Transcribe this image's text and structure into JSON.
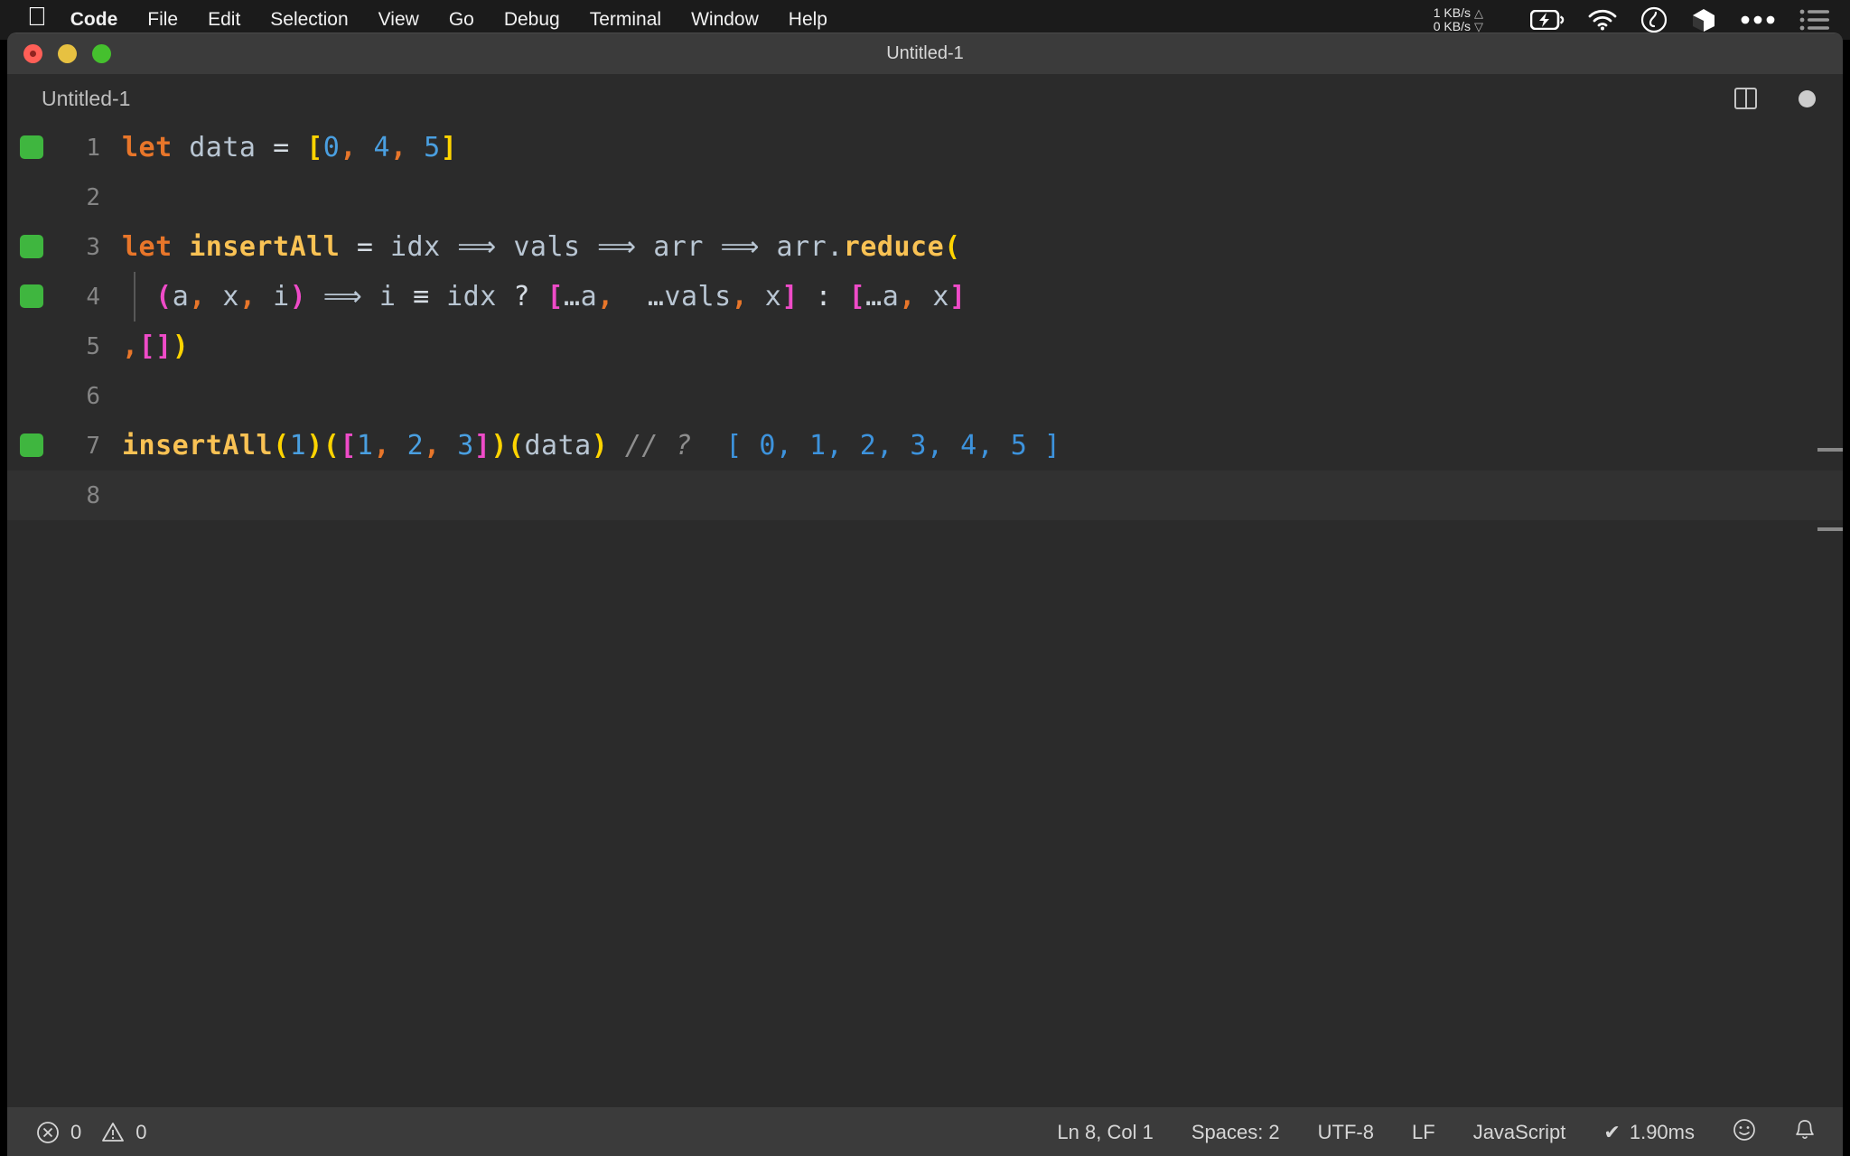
{
  "menubar": {
    "apple_icon": "apple-logo",
    "items": [
      {
        "label": "Code",
        "bold": true
      },
      {
        "label": "File",
        "bold": false
      },
      {
        "label": "Edit",
        "bold": false
      },
      {
        "label": "Selection",
        "bold": false
      },
      {
        "label": "View",
        "bold": false
      },
      {
        "label": "Go",
        "bold": false
      },
      {
        "label": "Debug",
        "bold": false
      },
      {
        "label": "Terminal",
        "bold": false
      },
      {
        "label": "Window",
        "bold": false
      },
      {
        "label": "Help",
        "bold": false
      }
    ],
    "network": {
      "up": "1 KB/s",
      "down": "0 KB/s",
      "up_arrow": "△",
      "down_arrow": "▽"
    },
    "tray_icons": [
      "battery-charging-icon",
      "wifi-icon",
      "clock-icon",
      "dropbox-icon",
      "ellipsis-icon",
      "control-center-icon"
    ]
  },
  "window": {
    "title": "Untitled-1",
    "traffic_lights": [
      "close-button",
      "minimize-button",
      "zoom-button"
    ]
  },
  "tabbar": {
    "tab_label": "Untitled-1",
    "split_icon": "split-editor-icon",
    "dirty_icon": "unsaved-changes-dot"
  },
  "editor": {
    "language": "JavaScript",
    "lines": [
      {
        "number": "1",
        "quokka": true,
        "current": false,
        "indent_guide": false,
        "tokens": [
          {
            "t": "let",
            "c": "t-kw"
          },
          {
            "t": " ",
            "c": "t-op"
          },
          {
            "t": "data",
            "c": "t-var"
          },
          {
            "t": " ",
            "c": "t-op"
          },
          {
            "t": "=",
            "c": "t-op"
          },
          {
            "t": " ",
            "c": "t-op"
          },
          {
            "t": "[",
            "c": "t-brkt-y"
          },
          {
            "t": "0",
            "c": "t-num"
          },
          {
            "t": ",",
            "c": "t-comma"
          },
          {
            "t": " ",
            "c": "t-op"
          },
          {
            "t": "4",
            "c": "t-num"
          },
          {
            "t": ",",
            "c": "t-comma"
          },
          {
            "t": " ",
            "c": "t-op"
          },
          {
            "t": "5",
            "c": "t-num"
          },
          {
            "t": "]",
            "c": "t-brkt-y"
          }
        ]
      },
      {
        "number": "2",
        "quokka": false,
        "current": false,
        "indent_guide": false,
        "tokens": []
      },
      {
        "number": "3",
        "quokka": true,
        "current": false,
        "indent_guide": false,
        "tokens": [
          {
            "t": "let",
            "c": "t-kw"
          },
          {
            "t": " ",
            "c": "t-op"
          },
          {
            "t": "insertAll",
            "c": "t-fn"
          },
          {
            "t": " ",
            "c": "t-op"
          },
          {
            "t": "=",
            "c": "t-op"
          },
          {
            "t": " ",
            "c": "t-op"
          },
          {
            "t": "idx",
            "c": "t-var"
          },
          {
            "t": " ",
            "c": "t-op"
          },
          {
            "t": "⟹",
            "c": "t-arrow"
          },
          {
            "t": " ",
            "c": "t-op"
          },
          {
            "t": "vals",
            "c": "t-var"
          },
          {
            "t": " ",
            "c": "t-op"
          },
          {
            "t": "⟹",
            "c": "t-arrow"
          },
          {
            "t": " ",
            "c": "t-op"
          },
          {
            "t": "arr",
            "c": "t-var"
          },
          {
            "t": " ",
            "c": "t-op"
          },
          {
            "t": "⟹",
            "c": "t-arrow"
          },
          {
            "t": " ",
            "c": "t-op"
          },
          {
            "t": "arr",
            "c": "t-var"
          },
          {
            "t": ".",
            "c": "t-var"
          },
          {
            "t": "reduce",
            "c": "t-fn"
          },
          {
            "t": "(",
            "c": "t-brkt-y"
          }
        ]
      },
      {
        "number": "4",
        "quokka": true,
        "current": false,
        "indent_guide": true,
        "tokens": [
          {
            "t": "  ",
            "c": "t-op"
          },
          {
            "t": "(",
            "c": "t-brkt-m"
          },
          {
            "t": "a",
            "c": "t-var"
          },
          {
            "t": ",",
            "c": "t-comma"
          },
          {
            "t": " ",
            "c": "t-op"
          },
          {
            "t": "x",
            "c": "t-var"
          },
          {
            "t": ",",
            "c": "t-comma"
          },
          {
            "t": " ",
            "c": "t-op"
          },
          {
            "t": "i",
            "c": "t-var"
          },
          {
            "t": ")",
            "c": "t-brkt-m"
          },
          {
            "t": " ",
            "c": "t-op"
          },
          {
            "t": "⟹",
            "c": "t-arrow"
          },
          {
            "t": " ",
            "c": "t-op"
          },
          {
            "t": "i",
            "c": "t-var"
          },
          {
            "t": " ",
            "c": "t-op"
          },
          {
            "t": "≡",
            "c": "t-op"
          },
          {
            "t": " ",
            "c": "t-op"
          },
          {
            "t": "idx",
            "c": "t-var"
          },
          {
            "t": " ",
            "c": "t-op"
          },
          {
            "t": "?",
            "c": "t-op"
          },
          {
            "t": " ",
            "c": "t-op"
          },
          {
            "t": "[",
            "c": "t-brkt-m"
          },
          {
            "t": "…",
            "c": "t-spread"
          },
          {
            "t": "a",
            "c": "t-var"
          },
          {
            "t": ",",
            "c": "t-comma"
          },
          {
            "t": "  ",
            "c": "t-op"
          },
          {
            "t": "…",
            "c": "t-spread"
          },
          {
            "t": "vals",
            "c": "t-var"
          },
          {
            "t": ",",
            "c": "t-comma"
          },
          {
            "t": " ",
            "c": "t-op"
          },
          {
            "t": "x",
            "c": "t-var"
          },
          {
            "t": "]",
            "c": "t-brkt-m"
          },
          {
            "t": " ",
            "c": "t-op"
          },
          {
            "t": ":",
            "c": "t-op"
          },
          {
            "t": " ",
            "c": "t-op"
          },
          {
            "t": "[",
            "c": "t-brkt-m"
          },
          {
            "t": "…",
            "c": "t-spread"
          },
          {
            "t": "a",
            "c": "t-var"
          },
          {
            "t": ",",
            "c": "t-comma"
          },
          {
            "t": " ",
            "c": "t-op"
          },
          {
            "t": "x",
            "c": "t-var"
          },
          {
            "t": "]",
            "c": "t-brkt-m"
          }
        ]
      },
      {
        "number": "5",
        "quokka": false,
        "current": false,
        "indent_guide": false,
        "tokens": [
          {
            "t": ",",
            "c": "t-comma"
          },
          {
            "t": "[",
            "c": "t-brkt-m"
          },
          {
            "t": "]",
            "c": "t-brkt-m"
          },
          {
            "t": ")",
            "c": "t-brkt-y"
          }
        ]
      },
      {
        "number": "6",
        "quokka": false,
        "current": false,
        "indent_guide": false,
        "tokens": []
      },
      {
        "number": "7",
        "quokka": true,
        "current": false,
        "indent_guide": false,
        "tokens": [
          {
            "t": "insertAll",
            "c": "t-fn"
          },
          {
            "t": "(",
            "c": "t-brkt-y"
          },
          {
            "t": "1",
            "c": "t-num"
          },
          {
            "t": ")",
            "c": "t-brkt-y"
          },
          {
            "t": "(",
            "c": "t-brkt-y"
          },
          {
            "t": "[",
            "c": "t-brkt-m"
          },
          {
            "t": "1",
            "c": "t-num"
          },
          {
            "t": ",",
            "c": "t-comma"
          },
          {
            "t": " ",
            "c": "t-op"
          },
          {
            "t": "2",
            "c": "t-num"
          },
          {
            "t": ",",
            "c": "t-comma"
          },
          {
            "t": " ",
            "c": "t-op"
          },
          {
            "t": "3",
            "c": "t-num"
          },
          {
            "t": "]",
            "c": "t-brkt-m"
          },
          {
            "t": ")",
            "c": "t-brkt-y"
          },
          {
            "t": "(",
            "c": "t-brkt-y"
          },
          {
            "t": "data",
            "c": "t-var"
          },
          {
            "t": ")",
            "c": "t-brkt-y"
          },
          {
            "t": " ",
            "c": "t-op"
          },
          {
            "t": "// ?",
            "c": "t-comment"
          },
          {
            "t": "  ",
            "c": "t-op"
          },
          {
            "t": "[ 0, 1, 2, 3, 4, 5 ]",
            "c": "t-result"
          }
        ]
      },
      {
        "number": "8",
        "quokka": false,
        "current": true,
        "indent_guide": false,
        "tokens": []
      }
    ]
  },
  "statusbar": {
    "errors": "0",
    "warnings": "0",
    "error_icon": "error-circle-icon",
    "warning_icon": "warning-triangle-icon",
    "cursor_position": "Ln 8, Col 1",
    "indentation": "Spaces: 2",
    "encoding": "UTF-8",
    "eol": "LF",
    "language": "JavaScript",
    "run_time": "1.90ms",
    "run_check": "✔",
    "feedback_icon": "smiley-icon",
    "notifications_icon": "bell-icon"
  },
  "colors": {
    "editor_background": "#2b2b2b",
    "chrome_background": "#3b3b3b",
    "keyword": "#e8762a",
    "function": "#f9c254",
    "number": "#4a9fe0",
    "bracket_yellow": "#ffd400",
    "bracket_magenta": "#ef4bc8",
    "variable": "#b9c6d3",
    "comment": "#8e8e8e",
    "quokka_pass": "#3fb63f"
  }
}
